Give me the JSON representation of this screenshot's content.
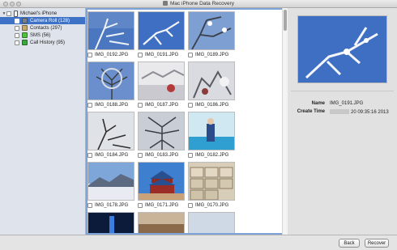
{
  "window": {
    "title": "Mac iPhone Data Recovery"
  },
  "sidebar": {
    "device": "Michael's iPhone",
    "items": [
      {
        "label": "Camera Roll (128)",
        "icon": "camera-icon",
        "selected": true
      },
      {
        "label": "Contacts (297)",
        "icon": "contacts-icon",
        "selected": false
      },
      {
        "label": "SMS (56)",
        "icon": "sms-icon",
        "selected": false
      },
      {
        "label": "Call History (95)",
        "icon": "call-history-icon",
        "selected": false
      }
    ]
  },
  "grid": {
    "items": [
      {
        "name": "IMG_0192.JPG"
      },
      {
        "name": "IMG_0191.JPG"
      },
      {
        "name": "IMG_0189.JPG"
      },
      {
        "name": "IMG_0188.JPG"
      },
      {
        "name": "IMG_0187.JPG"
      },
      {
        "name": "IMG_0186.JPG"
      },
      {
        "name": "IMG_0184.JPG"
      },
      {
        "name": "IMG_0183.JPG"
      },
      {
        "name": "IMG_0182.JPG"
      },
      {
        "name": "IMG_0178.JPG"
      },
      {
        "name": "IMG_0171.JPG"
      },
      {
        "name": "IMG_0170.JPG"
      }
    ]
  },
  "detail": {
    "name_label": "Name",
    "name_value": "IMG_0191.JPG",
    "time_label": "Create Time",
    "time_value": "20 09:35:16 2013"
  },
  "buttons": {
    "back": "Back",
    "recover": "Recover"
  },
  "colors": {
    "selection": "#3d72c7",
    "focus_border": "#7ea3d9"
  }
}
